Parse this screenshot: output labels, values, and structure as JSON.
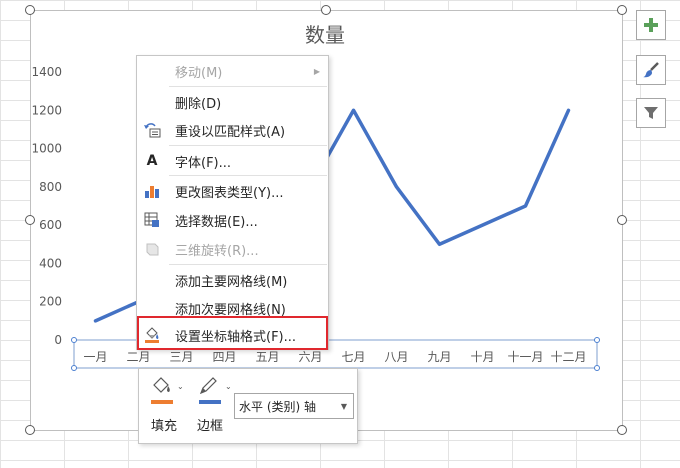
{
  "chart_data": {
    "type": "line",
    "title": "数量",
    "categories": [
      "一月",
      "二月",
      "三月",
      "四月",
      "五月",
      "六月",
      "七月",
      "八月",
      "九月",
      "十月",
      "十一月",
      "十二月"
    ],
    "series": [
      {
        "values": [
          100,
          200,
          300,
          400,
          600,
          800,
          1200,
          800,
          500,
          600,
          700,
          1200
        ]
      }
    ],
    "ylim": [
      0,
      1400
    ],
    "yticks": [
      "0",
      "200",
      "400",
      "600",
      "800",
      "1000",
      "1200",
      "1400"
    ],
    "line_color": "#4472c4",
    "grid": false,
    "legend": "none"
  },
  "side_buttons": {
    "add": "plus-icon",
    "style": "brush-icon",
    "filter": "funnel-icon"
  },
  "context_menu": {
    "items": [
      {
        "label": "移动(M)",
        "icon": "",
        "disabled": true,
        "submenu": true
      },
      {
        "label": "删除(D)",
        "icon": "",
        "disabled": false
      },
      {
        "label": "重设以匹配样式(A)",
        "icon": "reset-style-icon",
        "disabled": false
      },
      {
        "label": "字体(F)...",
        "icon": "font-icon",
        "disabled": false
      },
      {
        "label": "更改图表类型(Y)...",
        "icon": "chart-type-icon",
        "disabled": false
      },
      {
        "label": "选择数据(E)...",
        "icon": "select-data-icon",
        "disabled": false
      },
      {
        "label": "三维旋转(R)...",
        "icon": "3d-rotation-icon",
        "disabled": true
      },
      {
        "label": "添加主要网格线(M)",
        "icon": "",
        "disabled": false
      },
      {
        "label": "添加次要网格线(N)",
        "icon": "",
        "disabled": false
      },
      {
        "label": "设置坐标轴格式(F)...",
        "icon": "format-axis-icon",
        "disabled": false
      }
    ],
    "font_icon_glyph": "A",
    "highlight_color": "#e0282e"
  },
  "mini_toolbar": {
    "fill_label": "填充",
    "border_label": "边框",
    "fill_color": "#ed7d31",
    "border_color": "#4472c4",
    "element_select": "水平 (类别) 轴"
  }
}
